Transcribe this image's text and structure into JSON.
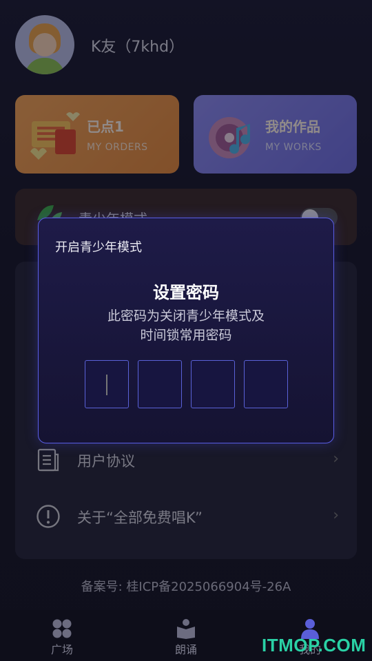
{
  "profile": {
    "username": "K友（7khd）"
  },
  "cards": {
    "orders": {
      "title": "已点1",
      "subtitle": "MY ORDERS"
    },
    "works": {
      "title": "我的作品",
      "subtitle": "MY WORKS"
    }
  },
  "teen_mode": {
    "label": "青少年模式",
    "enabled": false
  },
  "menu": {
    "items": [
      {
        "label": "用户协议",
        "icon": "document-icon"
      },
      {
        "label": "关于“全部免费唱K”",
        "icon": "info-icon"
      }
    ]
  },
  "icp": "备案号: 桂ICP备2025066904号-26A",
  "bottom_nav": {
    "items": [
      {
        "label": "广场",
        "icon": "grid-icon"
      },
      {
        "label": "朗诵",
        "icon": "book-icon"
      },
      {
        "label": "我的",
        "icon": "user-icon"
      }
    ]
  },
  "watermark": "ITMOP.COM",
  "modal": {
    "header": "开启青少年模式",
    "title": "设置密码",
    "desc_line1": "此密码为关闭青少年模式及",
    "desc_line2": "时间锁常用密码",
    "pin_length": 4
  },
  "colors": {
    "accent": "#5a5ee6",
    "orders_card": "#f2a356",
    "works_card": "#8d8cf0",
    "watermark": "#2ad1a5"
  }
}
